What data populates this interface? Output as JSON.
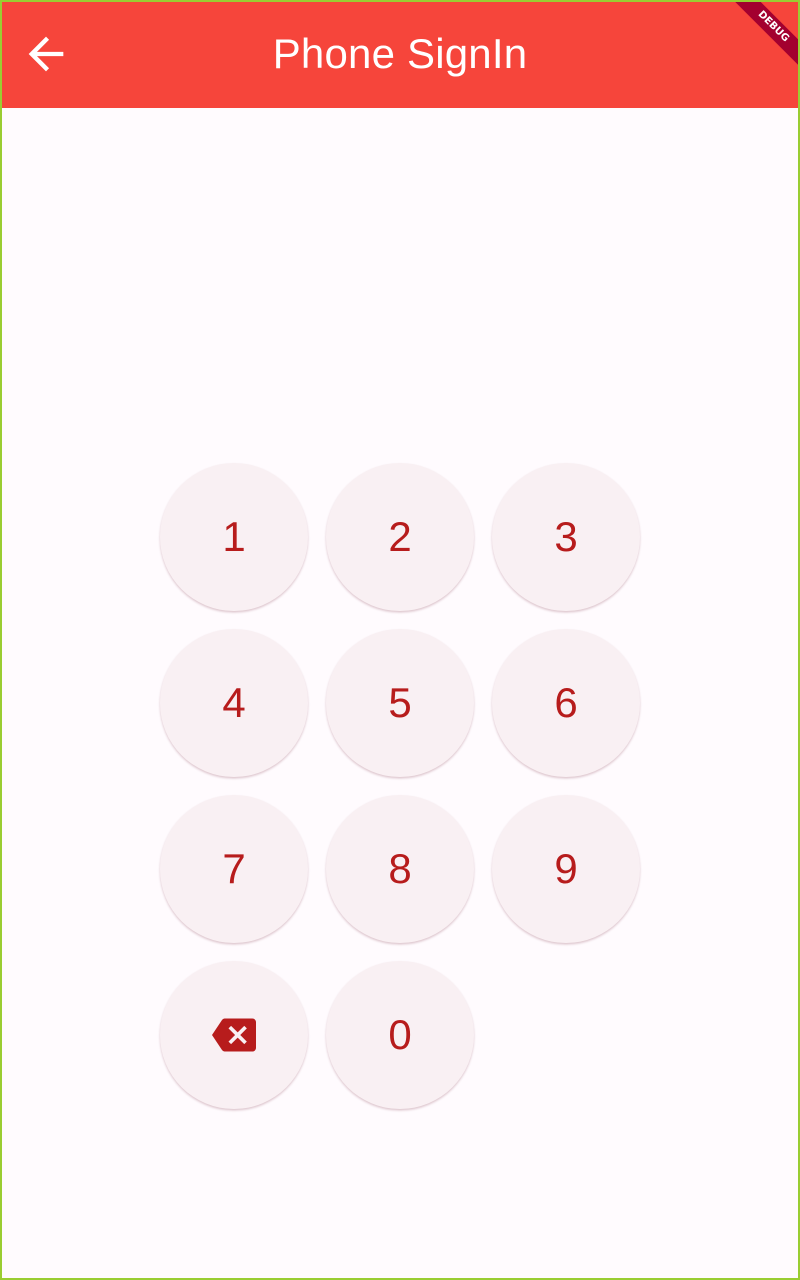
{
  "appbar": {
    "title": "Phone SignIn",
    "back_icon": "arrow-back-icon",
    "background": "#f6453b",
    "debug_label": "DEBUG"
  },
  "keypad": {
    "key_color": "#b71c1c",
    "key_background": "#f9f0f3",
    "keys": {
      "k1": "1",
      "k2": "2",
      "k3": "3",
      "k4": "4",
      "k5": "5",
      "k6": "6",
      "k7": "7",
      "k8": "8",
      "k9": "9",
      "k0": "0"
    },
    "backspace_icon": "backspace-icon"
  }
}
